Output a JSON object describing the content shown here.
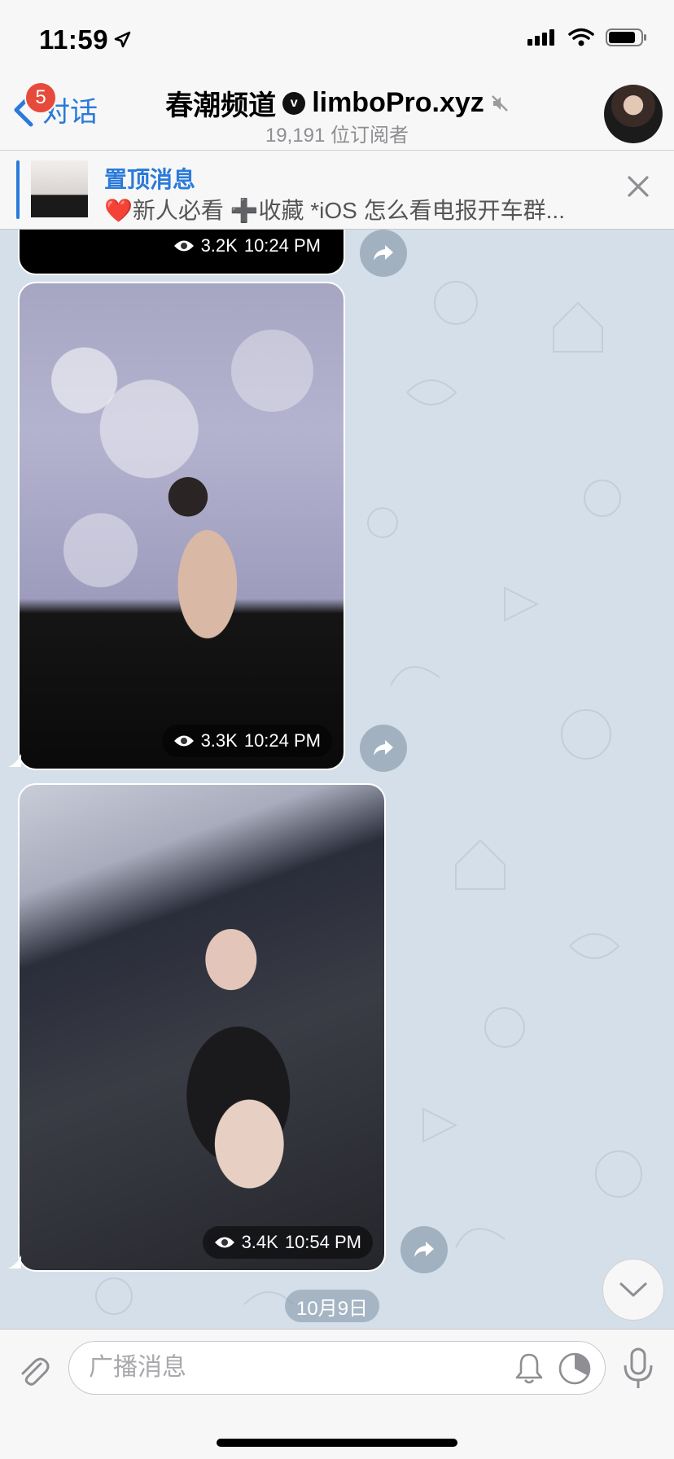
{
  "status_bar": {
    "time": "11:59",
    "icons": [
      "location-arrow-icon",
      "signal-icon",
      "wifi-icon",
      "battery-icon"
    ]
  },
  "header": {
    "back_label": "对话",
    "back_badge": "5",
    "title": "春潮频道",
    "title_suffix": "limboPro.xyz",
    "subtitle": "19,191 位订阅者",
    "icons": [
      "verified-icon",
      "muted-icon"
    ]
  },
  "pinned": {
    "title": "置顶消息",
    "text": "❤️新人必看 ➕收藏 *iOS 怎么看电报开车群..."
  },
  "messages": [
    {
      "views": "3.2K",
      "time": "10:24 PM"
    },
    {
      "views": "3.3K",
      "time": "10:24 PM"
    },
    {
      "views": "3.4K",
      "time": "10:54 PM"
    }
  ],
  "date_separator": "10月9日",
  "composer": {
    "placeholder": "广播消息"
  },
  "colors": {
    "accent": "#2a7ad9",
    "badge": "#e64a3c",
    "chat_background": "#d4dfe9"
  }
}
